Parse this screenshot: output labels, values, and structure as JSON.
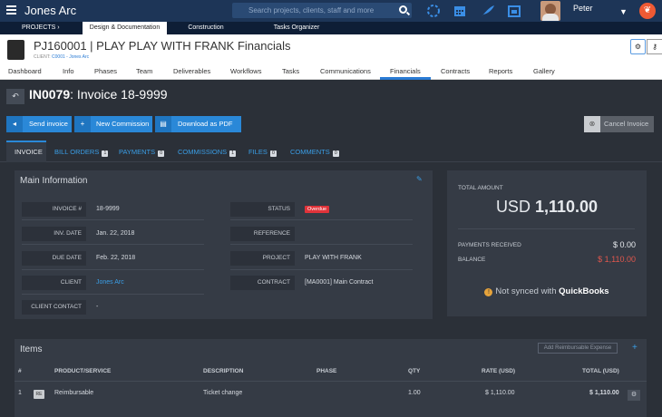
{
  "topbar": {
    "company": "Jones Arc",
    "search_placeholder": "Search projects, clients, staff and more",
    "user_name": "Peter",
    "icons": [
      "loading-icon",
      "calendar-icon",
      "feather-icon",
      "calendar-check-icon"
    ]
  },
  "subnav": {
    "projects": "PROJECTS",
    "design": "Design & Documentation",
    "construction": "Construction",
    "tasks": "Tasks Organizer"
  },
  "project": {
    "title": "PJ160001 | PLAY PLAY WITH FRANK Financials",
    "client_prefix": "CLIENT:",
    "client_value": "C0001 - Jones Arc"
  },
  "tabs": [
    "Dashboard",
    "Info",
    "Phases",
    "Team",
    "Deliverables",
    "Workflows",
    "Tasks",
    "Communications",
    "Financials",
    "Contracts",
    "Reports",
    "Gallery"
  ],
  "invoice": {
    "id": "IN0079",
    "title": ": Invoice 18-9999"
  },
  "actions": {
    "send": "Send invoice",
    "commission": "New Commission",
    "pdf": "Download as PDF",
    "cancel": "Cancel Invoice"
  },
  "subtabs": [
    {
      "label": "INVOICE",
      "count": ""
    },
    {
      "label": "BILL ORDERS",
      "count": "1"
    },
    {
      "label": "PAYMENTS",
      "count": "0"
    },
    {
      "label": "COMMISSIONS",
      "count": "1"
    },
    {
      "label": "FILES",
      "count": "0"
    },
    {
      "label": "COMMENTS",
      "count": "0"
    }
  ],
  "main_info": {
    "title": "Main Information",
    "invoice_no_label": "INVOICE #",
    "invoice_no": "18-9999",
    "inv_date_label": "INV. DATE",
    "inv_date": "Jan. 22, 2018",
    "due_date_label": "DUE DATE",
    "due_date": "Feb. 22, 2018",
    "client_label": "CLIENT",
    "client": "Jones Arc",
    "client_contact_label": "CLIENT CONTACT",
    "client_contact": "-",
    "status_label": "STATUS",
    "status": "Overdue",
    "reference_label": "REFERENCE",
    "reference": "",
    "project_label": "PROJECT",
    "project": "PLAY WITH FRANK",
    "contract_label": "CONTRACT",
    "contract": "[MA0001] Main Contract"
  },
  "totals": {
    "total_label": "TOTAL AMOUNT",
    "currency": "USD",
    "total": "1,110.00",
    "payments_label": "PAYMENTS RECEIVED",
    "payments": "$ 0.00",
    "balance_label": "BALANCE",
    "balance": "$ 1,110.00",
    "qb_text": "Not synced with",
    "qb_brand": "QuickBooks"
  },
  "items": {
    "title": "Items",
    "add_expense": "Add Reimbursable Expense",
    "headers": [
      "#",
      "PRODUCT/SERVICE",
      "DESCRIPTION",
      "PHASE",
      "QTY",
      "RATE (USD)",
      "TOTAL (USD)"
    ],
    "rows": [
      {
        "num": "1",
        "badge": "RE",
        "product": "Reimbursable",
        "description": "Ticket change",
        "phase": "",
        "qty": "1.00",
        "rate": "$ 1,110.00",
        "total": "$ 1,110.00"
      }
    ]
  },
  "colors": {
    "accent": "#2a88d8",
    "overdue": "#e0333a",
    "balance": "#e0574d",
    "topbar": "#1d3557"
  }
}
